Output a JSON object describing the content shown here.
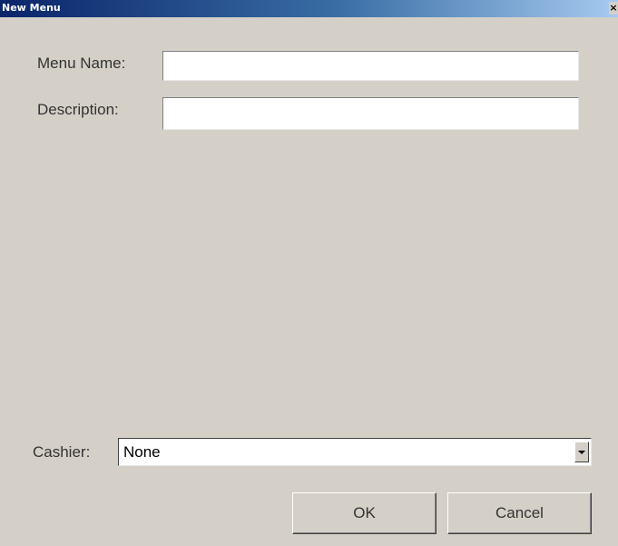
{
  "window": {
    "title": "New Menu",
    "close_glyph": "×"
  },
  "form": {
    "menu_name_label": "Menu Name:",
    "menu_name_value": "",
    "description_label": "Description:",
    "description_value": "",
    "cashier_label": "Cashier:",
    "cashier_selected": "None"
  },
  "buttons": {
    "ok_label": "OK",
    "cancel_label": "Cancel"
  },
  "icons": {
    "close": "close-icon",
    "dropdown": "chevron-down-icon"
  }
}
